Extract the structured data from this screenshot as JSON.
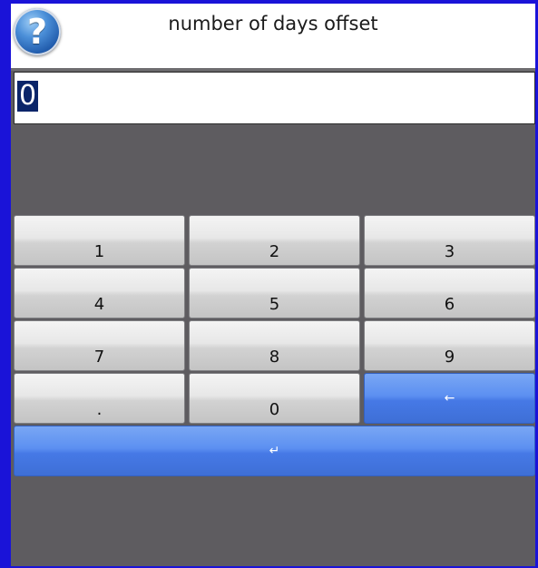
{
  "dialog": {
    "title": "number of days offset",
    "help_icon": "question-mark-icon"
  },
  "display": {
    "value": "0"
  },
  "keypad": {
    "keys": [
      "1",
      "2",
      "3",
      "4",
      "5",
      "6",
      "7",
      "8",
      "9",
      ".",
      "0"
    ],
    "backspace_symbol": "←",
    "enter_symbol": "↵"
  },
  "colors": {
    "frame_border": "#1a13d8",
    "background": "#5e5c60",
    "selection": "#0b2569",
    "action_button": "#5c8ff1"
  }
}
